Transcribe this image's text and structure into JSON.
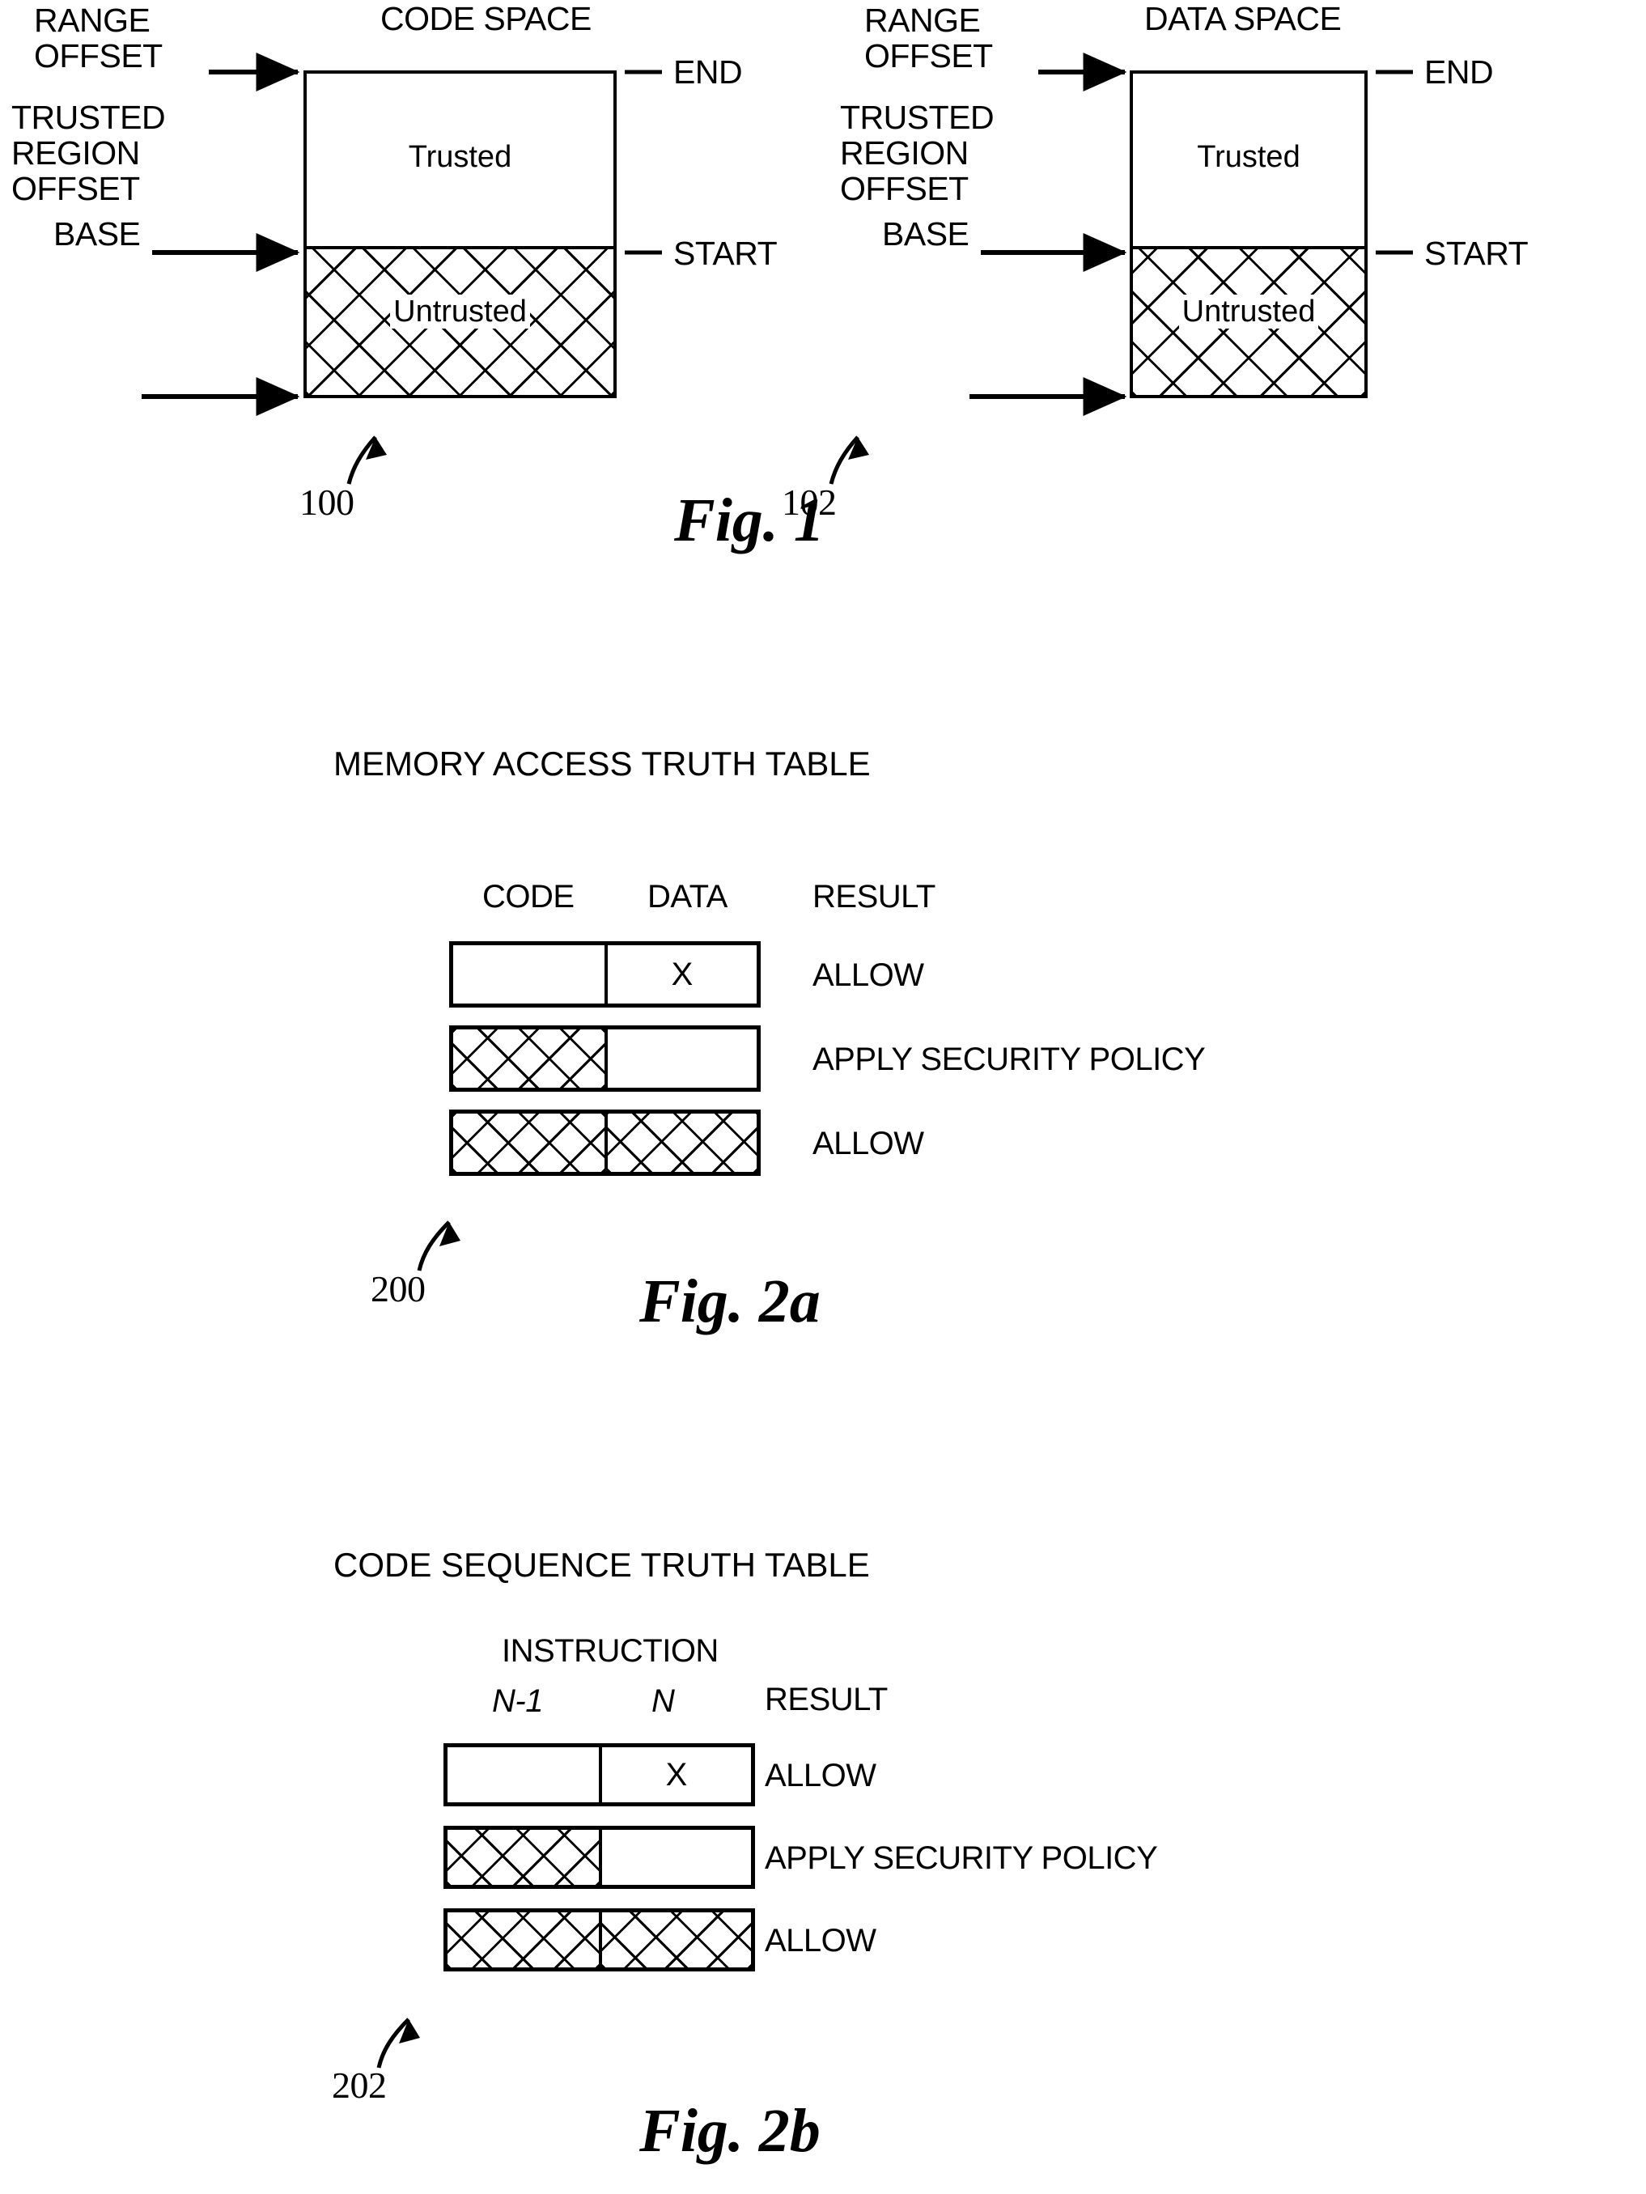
{
  "figure1": {
    "caption": "Fig. 1",
    "panels": [
      {
        "title": "CODE SPACE",
        "ref": "100",
        "left_labels": [
          {
            "line1": "RANGE",
            "line2": "OFFSET"
          },
          {
            "line1": "TRUSTED",
            "line2": "REGION",
            "line3": "OFFSET"
          },
          {
            "line1": "BASE"
          }
        ],
        "right_labels": [
          "END",
          "START"
        ],
        "regions": [
          {
            "name": "Trusted",
            "fill": "plain"
          },
          {
            "name": "Untrusted",
            "fill": "crosshatch"
          }
        ]
      },
      {
        "title": "DATA SPACE",
        "ref": "102",
        "left_labels": [
          {
            "line1": "RANGE",
            "line2": "OFFSET"
          },
          {
            "line1": "TRUSTED",
            "line2": "REGION",
            "line3": "OFFSET"
          },
          {
            "line1": "BASE"
          }
        ],
        "right_labels": [
          "END",
          "START"
        ],
        "regions": [
          {
            "name": "Trusted",
            "fill": "plain"
          },
          {
            "name": "Untrusted",
            "fill": "crosshatch"
          }
        ]
      }
    ]
  },
  "figure2a": {
    "title": "MEMORY ACCESS TRUTH TABLE",
    "caption": "Fig. 2a",
    "ref": "200",
    "columns": [
      "CODE",
      "DATA",
      "RESULT"
    ],
    "rows": [
      {
        "code": "plain",
        "code_mark": "",
        "data": "plain",
        "data_mark": "X",
        "result": "ALLOW"
      },
      {
        "code": "crosshatch",
        "code_mark": "",
        "data": "plain",
        "data_mark": "",
        "result": "APPLY SECURITY POLICY"
      },
      {
        "code": "crosshatch",
        "code_mark": "",
        "data": "crosshatch",
        "data_mark": "",
        "result": "ALLOW"
      }
    ]
  },
  "figure2b": {
    "title": "CODE SEQUENCE TRUTH TABLE",
    "caption": "Fig. 2b",
    "ref": "202",
    "group_header": "INSTRUCTION",
    "columns": [
      "N-1",
      "N",
      "RESULT"
    ],
    "rows": [
      {
        "code": "plain",
        "code_mark": "",
        "data": "plain",
        "data_mark": "X",
        "result": "ALLOW"
      },
      {
        "code": "crosshatch",
        "code_mark": "",
        "data": "plain",
        "data_mark": "",
        "result": "APPLY SECURITY POLICY"
      },
      {
        "code": "crosshatch",
        "code_mark": "",
        "data": "crosshatch",
        "data_mark": "",
        "result": "ALLOW"
      }
    ]
  },
  "colors": {
    "ink": "#000000",
    "paper": "#ffffff"
  }
}
